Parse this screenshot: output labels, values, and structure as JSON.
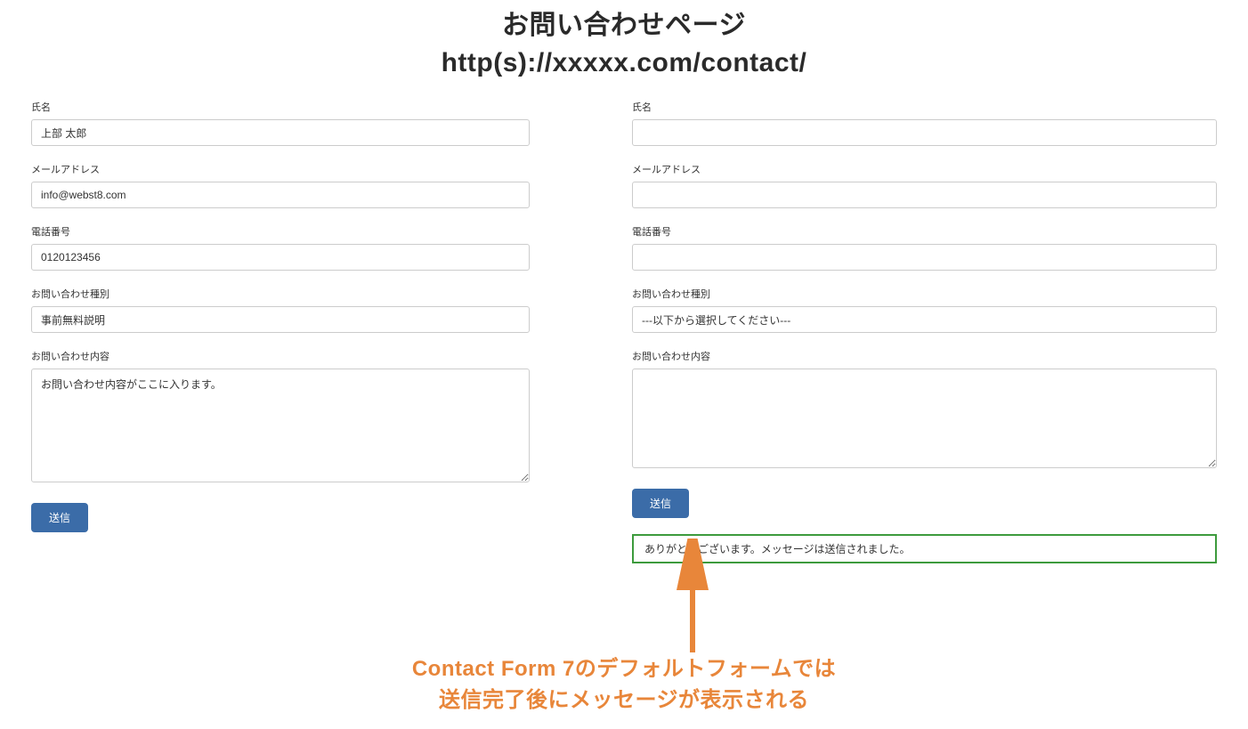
{
  "header": {
    "title_line1": "お問い合わせページ",
    "title_line2": "http(s)://xxxxx.com/contact/"
  },
  "left_form": {
    "name_label": "氏名",
    "name_value": "上部 太郎",
    "email_label": "メールアドレス",
    "email_value": "info@webst8.com",
    "phone_label": "電話番号",
    "phone_value": "0120123456",
    "type_label": "お問い合わせ種別",
    "type_value": "事前無料説明",
    "content_label": "お問い合わせ内容",
    "content_value": "お問い合わせ内容がここに入ります。",
    "submit_label": "送信"
  },
  "right_form": {
    "name_label": "氏名",
    "name_value": "",
    "email_label": "メールアドレス",
    "email_value": "",
    "phone_label": "電話番号",
    "phone_value": "",
    "type_label": "お問い合わせ種別",
    "type_placeholder": "---以下から選択してください---",
    "content_label": "お問い合わせ内容",
    "content_value": "",
    "submit_label": "送信",
    "success_message": "ありがとうございます。メッセージは送信されました。"
  },
  "annotation": {
    "line1": "Contact Form 7のデフォルトフォームでは",
    "line2": "送信完了後にメッセージが表示される"
  },
  "colors": {
    "submit_button": "#3b6ca8",
    "success_border": "#3d9b3d",
    "annotation": "#e8863a"
  }
}
